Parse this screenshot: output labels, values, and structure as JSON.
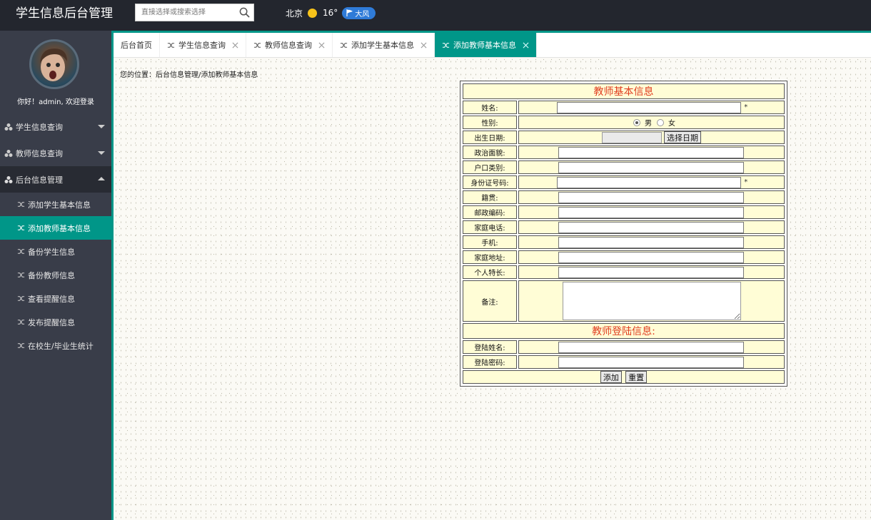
{
  "header": {
    "title": "学生信息后台管理",
    "search_placeholder": "直接选择或搜索选择",
    "weather": {
      "city": "北京",
      "temp": "16°",
      "wind": "大风",
      "sun_color": "#f7c31a"
    }
  },
  "sidebar": {
    "welcome": "你好！admin, 欢迎登录",
    "groups": [
      {
        "label": "学生信息查询",
        "expanded": false
      },
      {
        "label": "教师信息查询",
        "expanded": false
      },
      {
        "label": "后台信息管理",
        "expanded": true
      }
    ],
    "items": [
      {
        "label": "添加学生基本信息",
        "active": false
      },
      {
        "label": "添加教师基本信息",
        "active": true
      },
      {
        "label": "备份学生信息",
        "active": false
      },
      {
        "label": "备份教师信息",
        "active": false
      },
      {
        "label": "查看提醒信息",
        "active": false
      },
      {
        "label": "发布提醒信息",
        "active": false
      },
      {
        "label": "在校生/毕业生统计",
        "active": false
      }
    ]
  },
  "tabs": [
    {
      "label": "后台首页"
    },
    {
      "label": "学生信息查询"
    },
    {
      "label": "教师信息查询"
    },
    {
      "label": "添加学生基本信息"
    },
    {
      "label": "添加教师基本信息"
    }
  ],
  "breadcrumb": "您的位置：后台信息管理/添加教师基本信息",
  "form": {
    "title": "教师基本信息",
    "name_label": "姓名:",
    "required_mark": "*",
    "gender_label": "性别:",
    "gender_options": [
      "男",
      "女"
    ],
    "gender_selected": "男",
    "birth_label": "出生日期:",
    "date_button": "选择日期",
    "politics_label": "政治面貌:",
    "hukou_label": "户口类别:",
    "idcard_label": "身份证号码:",
    "native_label": "籍贯:",
    "postcode_label": "邮政编码:",
    "phone_label": "家庭电话:",
    "mobile_label": "手机:",
    "address_label": "家庭地址:",
    "specialty_label": "个人特长:",
    "notes_label": "备注:",
    "login_title": "教师登陆信息:",
    "login_name_label": "登陆姓名:",
    "login_pwd_label": "登陆密码:",
    "submit_button": "添加",
    "reset_button": "重置"
  },
  "colors": {
    "accent": "#009688",
    "header_bg": "#23262e",
    "sidebar_bg": "#393d49",
    "form_title": "#e03c1f"
  }
}
